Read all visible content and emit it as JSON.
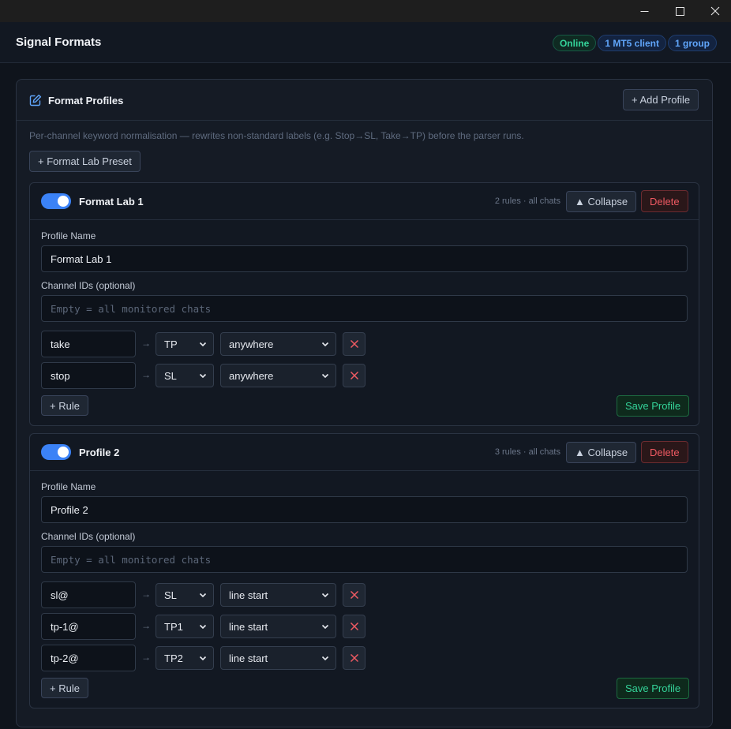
{
  "window": {
    "minimize": "—",
    "maximize": "☐",
    "close": "✕"
  },
  "header": {
    "title": "Signal Formats",
    "badges": {
      "online": "Online",
      "client": "1 MT5 client",
      "group": "1 group"
    }
  },
  "panel": {
    "title": "Format Profiles",
    "add_profile": "+ Add Profile",
    "description": "Per-channel keyword normalisation — rewrites non-standard labels (e.g. Stop→SL, Take→TP) before the parser runs.",
    "preset_button": "+ Format Lab Preset"
  },
  "labels": {
    "profile_name": "Profile Name",
    "channel_ids": "Channel IDs (optional)",
    "channel_placeholder": "Empty = all monitored chats",
    "collapse": "▲ Collapse",
    "delete": "Delete",
    "add_rule": "+ Rule",
    "save": "Save Profile",
    "arrow": "→"
  },
  "profiles": [
    {
      "name": "Format Lab 1",
      "meta": "2 rules · all chats",
      "enabled": true,
      "rules": [
        {
          "key": "take",
          "target": "TP",
          "position": "anywhere"
        },
        {
          "key": "stop",
          "target": "SL",
          "position": "anywhere"
        }
      ]
    },
    {
      "name": "Profile 2",
      "meta": "3 rules · all chats",
      "enabled": true,
      "rules": [
        {
          "key": "sl@",
          "target": "SL",
          "position": "line start"
        },
        {
          "key": "tp-1@",
          "target": "TP1",
          "position": "line start"
        },
        {
          "key": "tp-2@",
          "target": "TP2",
          "position": "line start"
        }
      ]
    }
  ],
  "colors": {
    "accent": "#3b82f6",
    "danger": "#f05a62",
    "success": "#34d399"
  }
}
